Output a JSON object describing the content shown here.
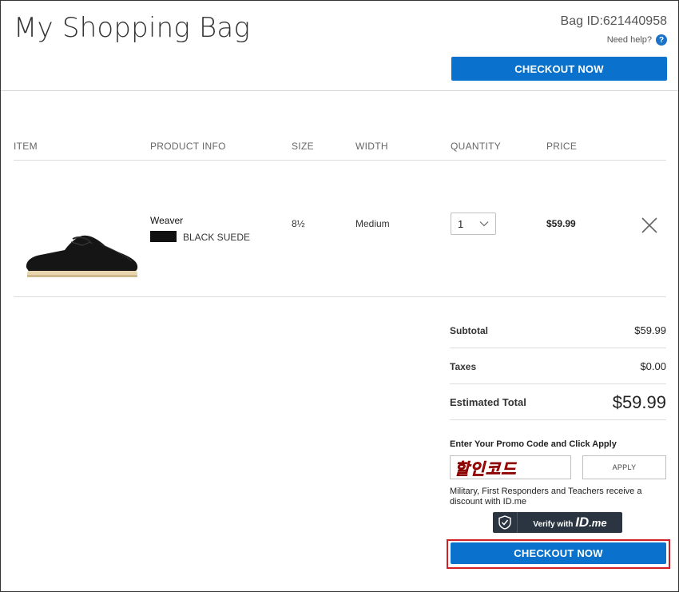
{
  "header": {
    "title": "My Shopping Bag",
    "bag_id": "Bag ID:621440958",
    "help_text": "Need help?",
    "help_icon": "?",
    "checkout_label": "CHECKOUT NOW"
  },
  "columns": [
    "ITEM",
    "PRODUCT INFO",
    "SIZE",
    "WIDTH",
    "QUANTITY",
    "PRICE"
  ],
  "item": {
    "name": "Weaver",
    "color": "BLACK SUEDE",
    "swatch_color": "#111111",
    "size": "8½",
    "width": "Medium",
    "quantity": "1",
    "price": "$59.99"
  },
  "summary": {
    "subtotal_label": "Subtotal",
    "subtotal": "$59.99",
    "taxes_label": "Taxes",
    "taxes": "$0.00",
    "total_label": "Estimated Total",
    "total": "$59.99"
  },
  "promo": {
    "label": "Enter Your Promo Code and Click Apply",
    "value": "할인코드",
    "apply_label": "APPLY"
  },
  "discount": {
    "text": "Military, First Responders and Teachers receive a discount with ID.me",
    "verify_prefix": "Verify with",
    "verify_brand": "ID",
    "verify_suffix": ".me"
  },
  "footer": {
    "checkout_label": "CHECKOUT NOW"
  },
  "colors": {
    "accent": "#0a72cc",
    "highlight": "#d32027",
    "idme_bg": "#2b3542",
    "promo_text": "#f7271b"
  }
}
